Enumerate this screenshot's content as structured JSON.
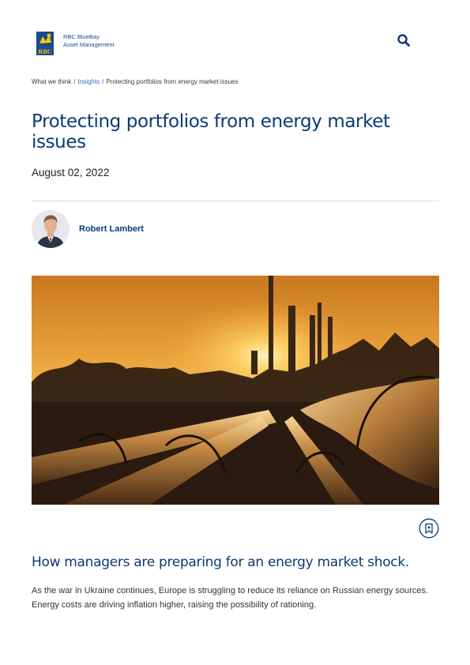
{
  "header": {
    "logo_line1": "RBC BlueBay",
    "logo_line2": "Asset Management",
    "logo_mark_text": "RBC",
    "search_icon": "search-icon"
  },
  "breadcrumb": {
    "items": [
      "What we think",
      "Insights",
      "Protecting portfolios from energy market issues"
    ],
    "separator": "/"
  },
  "article": {
    "title": "Protecting portfolios from energy market issues",
    "date": "August 02, 2022",
    "author": "Robert Lambert",
    "subheading": "How managers are preparing for an energy market shock.",
    "intro": "As the war in Ukraine continues, Europe is struggling to reduce its reliance on Russian energy sources. Energy costs are driving inflation higher, raising the possibility of rationing.",
    "bookmark_icon": "bookmark-icon"
  },
  "colors": {
    "brand_navy": "#0b3a73",
    "brand_blue": "#1a4b8c",
    "link_blue": "#2a6fc4",
    "logo_yellow": "#f6c800"
  }
}
